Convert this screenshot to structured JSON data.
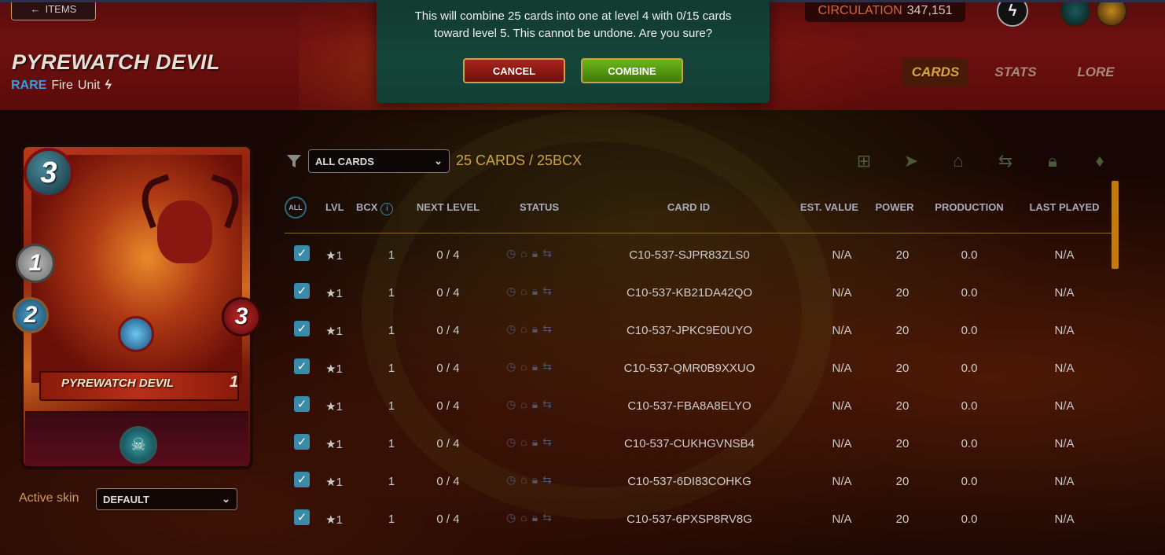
{
  "nav": {
    "items_label": "ITEMS"
  },
  "card": {
    "title": "PYREWATCH DEVIL",
    "rarity": "RARE",
    "element": "Fire",
    "type": "Unit",
    "name_on_card": "PYREWATCH DEVIL",
    "level_on_card": "1",
    "mana": "3",
    "attack": "1",
    "speed": "2",
    "health": "3"
  },
  "circulation": {
    "label": "CIRCULATION",
    "value": "347,151"
  },
  "tabs": [
    {
      "label": "CARDS",
      "active": true
    },
    {
      "label": "STATS",
      "active": false
    },
    {
      "label": "LORE",
      "active": false
    }
  ],
  "skin": {
    "label": "Active skin",
    "selected": "DEFAULT"
  },
  "filter": {
    "selected": "ALL CARDS",
    "count_text": "25 CARDS / 25BCX"
  },
  "table": {
    "all_label": "ALL",
    "headers": [
      "LVL",
      "BCX",
      "NEXT LEVEL",
      "STATUS",
      "CARD ID",
      "EST. VALUE",
      "POWER",
      "PRODUCTION",
      "LAST PLAYED"
    ],
    "rows": [
      {
        "lvl": "★1",
        "bcx": "1",
        "next": "0 / 4",
        "id": "C10-537-SJPR83ZLS0",
        "value": "N/A",
        "power": "20",
        "production": "0.0",
        "last": "N/A"
      },
      {
        "lvl": "★1",
        "bcx": "1",
        "next": "0 / 4",
        "id": "C10-537-KB21DA42QO",
        "value": "N/A",
        "power": "20",
        "production": "0.0",
        "last": "N/A"
      },
      {
        "lvl": "★1",
        "bcx": "1",
        "next": "0 / 4",
        "id": "C10-537-JPKC9E0UYO",
        "value": "N/A",
        "power": "20",
        "production": "0.0",
        "last": "N/A"
      },
      {
        "lvl": "★1",
        "bcx": "1",
        "next": "0 / 4",
        "id": "C10-537-QMR0B9XXUO",
        "value": "N/A",
        "power": "20",
        "production": "0.0",
        "last": "N/A"
      },
      {
        "lvl": "★1",
        "bcx": "1",
        "next": "0 / 4",
        "id": "C10-537-FBA8A8ELYO",
        "value": "N/A",
        "power": "20",
        "production": "0.0",
        "last": "N/A"
      },
      {
        "lvl": "★1",
        "bcx": "1",
        "next": "0 / 4",
        "id": "C10-537-CUKHGVNSB4",
        "value": "N/A",
        "power": "20",
        "production": "0.0",
        "last": "N/A"
      },
      {
        "lvl": "★1",
        "bcx": "1",
        "next": "0 / 4",
        "id": "C10-537-6DI83COHKG",
        "value": "N/A",
        "power": "20",
        "production": "0.0",
        "last": "N/A"
      },
      {
        "lvl": "★1",
        "bcx": "1",
        "next": "0 / 4",
        "id": "C10-537-6PXSP8RV8G",
        "value": "N/A",
        "power": "20",
        "production": "0.0",
        "last": "N/A"
      }
    ]
  },
  "modal": {
    "line1": "This will combine 25 cards into one at level 4 with 0/15 cards",
    "line2": "toward level 5. This cannot be undone. Are you sure?",
    "cancel_label": "CANCEL",
    "combine_label": "COMBINE"
  },
  "colors": {
    "accent_gold": "#c9a24a",
    "rarity_blue": "#3b9be0",
    "checkbox_blue": "#3a8aaa"
  }
}
